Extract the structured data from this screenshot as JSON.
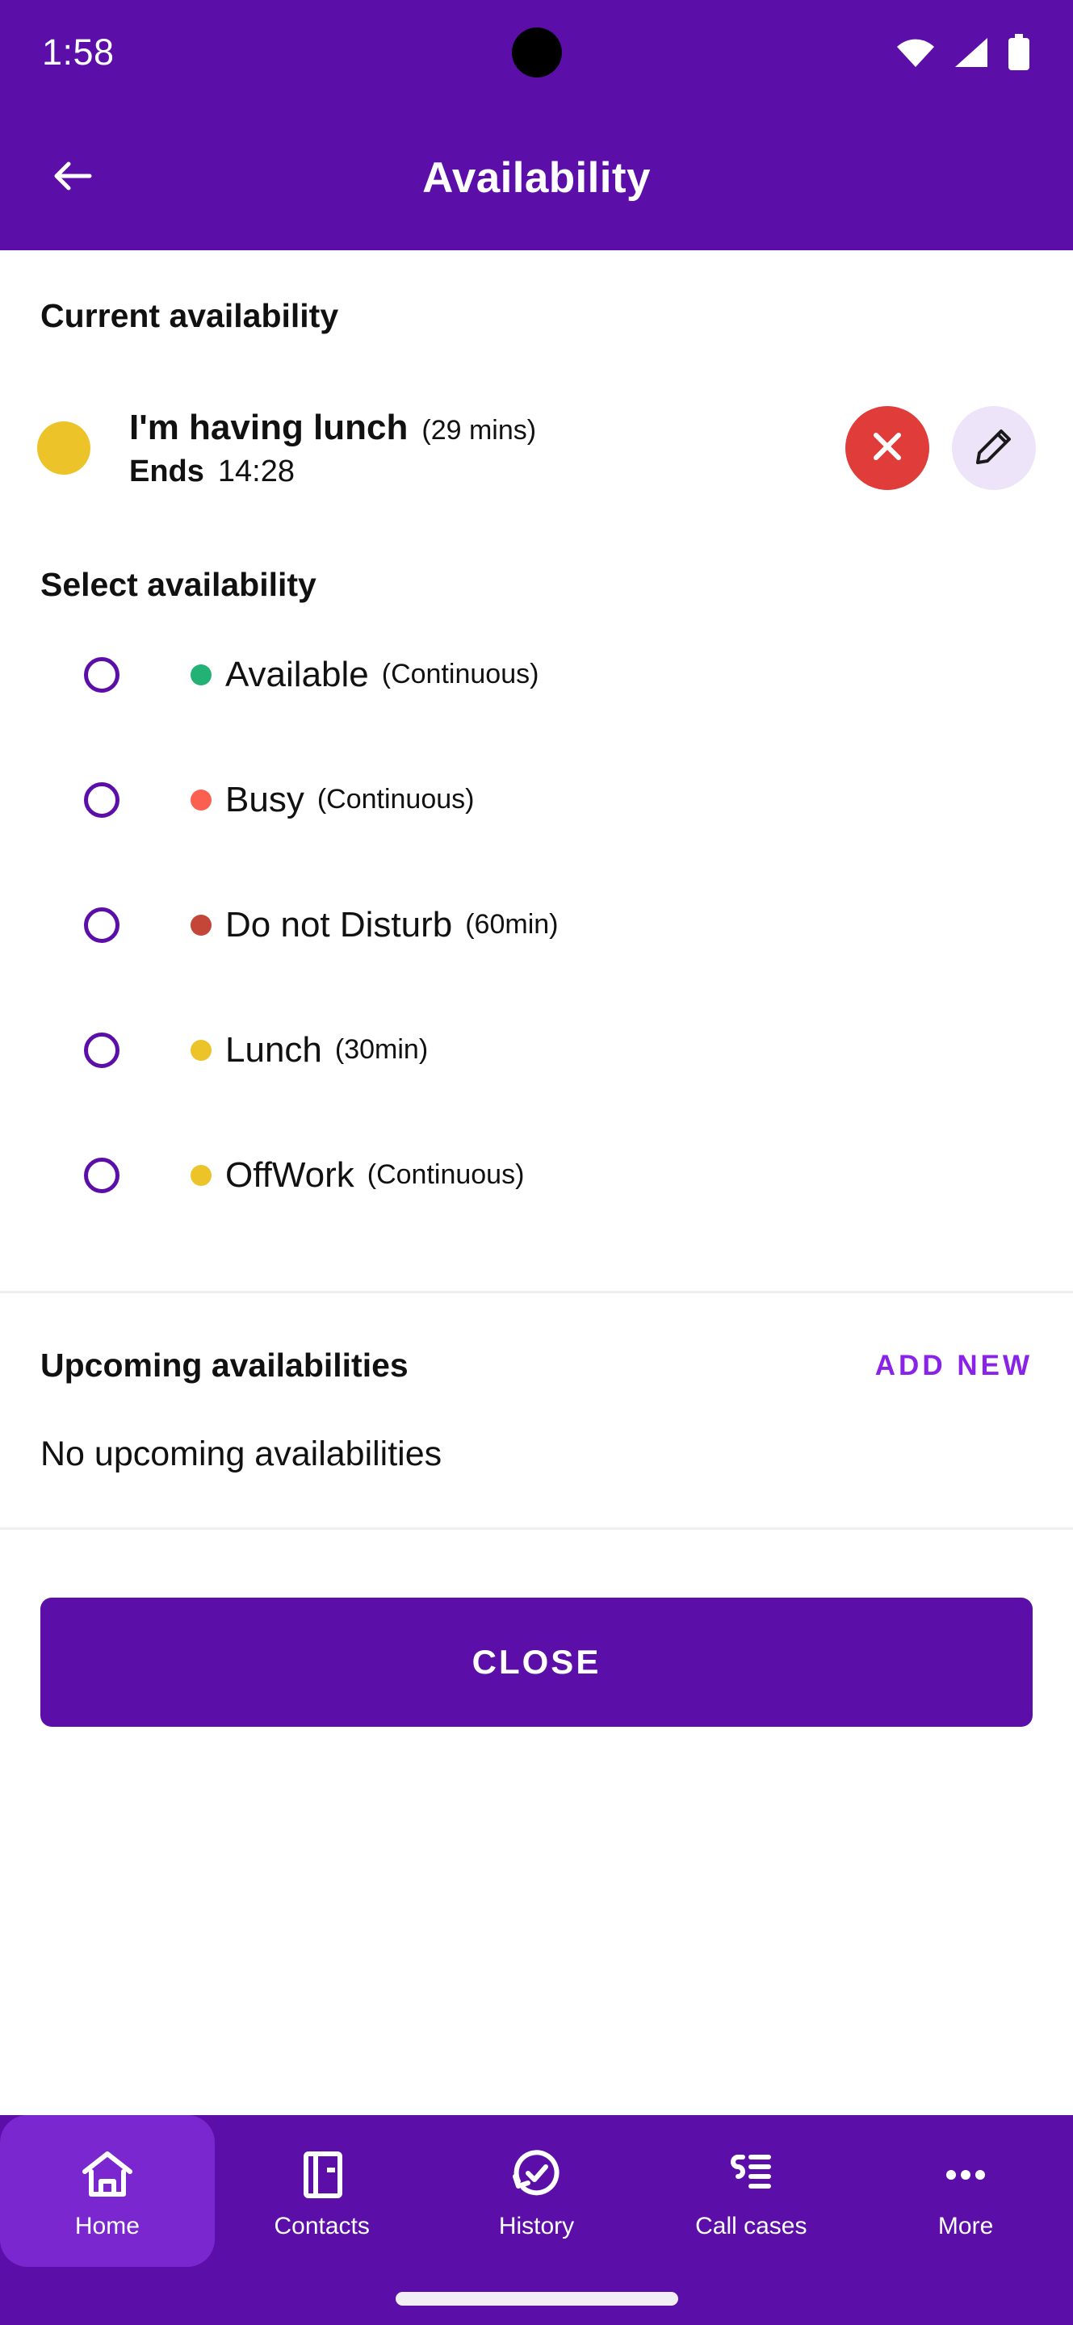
{
  "status_bar": {
    "clock": "1:58",
    "icons": [
      "wifi-icon",
      "signal-icon",
      "battery-icon"
    ]
  },
  "app_bar": {
    "back_icon": "back-arrow-icon",
    "title": "Availability"
  },
  "current_availability": {
    "heading": "Current availability",
    "status_color": "#edc32a",
    "name": "I'm having lunch",
    "duration": "(29 mins)",
    "ends_label": "Ends",
    "ends_time": "14:28",
    "cancel_icon": "close-x-icon",
    "cancel_color": "#e03c39",
    "edit_icon": "pencil-edit-icon",
    "edit_bg": "#eee4fa"
  },
  "select_availability": {
    "heading": "Select availability",
    "options": [
      {
        "label": "Available",
        "duration": "(Continuous)",
        "color": "#22b275",
        "selected": false
      },
      {
        "label": "Busy",
        "duration": "(Continuous)",
        "color": "#fb5f50",
        "selected": false
      },
      {
        "label": "Do not Disturb",
        "duration": "(60min)",
        "color": "#c44638",
        "selected": false
      },
      {
        "label": "Lunch",
        "duration": "(30min)",
        "color": "#edc32a",
        "selected": false
      },
      {
        "label": "OffWork",
        "duration": "(Continuous)",
        "color": "#edc32a",
        "selected": false
      }
    ]
  },
  "upcoming": {
    "heading": "Upcoming availabilities",
    "add_new_label": "ADD NEW",
    "empty_text": "No upcoming availabilities"
  },
  "actions": {
    "close_label": "CLOSE"
  },
  "bottom_nav": {
    "items": [
      {
        "label": "Home",
        "icon": "home-icon",
        "active": true
      },
      {
        "label": "Contacts",
        "icon": "contacts-icon",
        "active": false
      },
      {
        "label": "History",
        "icon": "history-icon",
        "active": false
      },
      {
        "label": "Call cases",
        "icon": "call-cases-icon",
        "active": false
      },
      {
        "label": "More",
        "icon": "more-dots-icon",
        "active": false
      }
    ]
  },
  "colors": {
    "brand_purple": "#5c0ea8",
    "accent_purple": "#8a23e8",
    "nav_active": "#7a27cf"
  }
}
